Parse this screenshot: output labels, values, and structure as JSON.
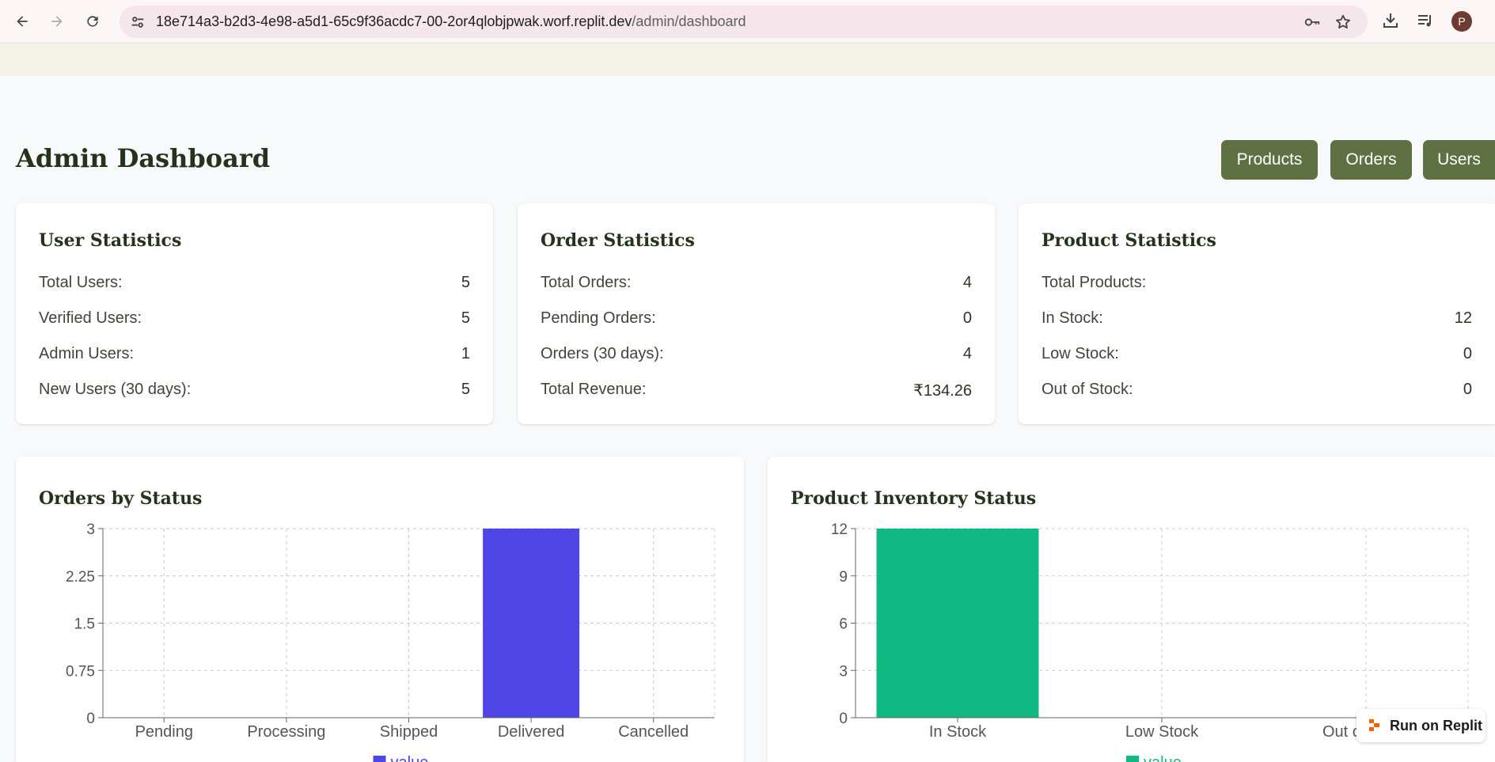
{
  "browser": {
    "url_host": "18e714a3-b2d3-4e98-a5d1-65c9f36acdc7-00-2or4qlobjpwak.worf.replit.dev",
    "url_path": "/admin/dashboard",
    "avatar_letter": "P",
    "icons": [
      "back-icon",
      "forward-icon",
      "reload-icon",
      "site-settings-icon",
      "password-key-icon",
      "bookmark-star-icon",
      "download-icon",
      "media-queue-icon"
    ]
  },
  "page": {
    "title": "Admin Dashboard",
    "nav_buttons": [
      "Products",
      "Orders",
      "Users"
    ],
    "accent_color": "#5f7142"
  },
  "user_stats": {
    "title": "User Statistics",
    "rows": [
      {
        "label": "Total Users:",
        "value": "5"
      },
      {
        "label": "Verified Users:",
        "value": "5"
      },
      {
        "label": "Admin Users:",
        "value": "1"
      },
      {
        "label": "New Users (30 days):",
        "value": "5"
      }
    ]
  },
  "order_stats": {
    "title": "Order Statistics",
    "rows": [
      {
        "label": "Total Orders:",
        "value": "4"
      },
      {
        "label": "Pending Orders:",
        "value": "0"
      },
      {
        "label": "Orders (30 days):",
        "value": "4"
      },
      {
        "label": "Total Revenue:",
        "value": "₹134.26"
      }
    ]
  },
  "product_stats": {
    "title": "Product Statistics",
    "rows": [
      {
        "label": "Total Products:",
        "value": ""
      },
      {
        "label": "In Stock:",
        "value": "12"
      },
      {
        "label": "Low Stock:",
        "value": "0"
      },
      {
        "label": "Out of Stock:",
        "value": "0"
      }
    ]
  },
  "chart_data": [
    {
      "type": "bar",
      "title": "Orders by Status",
      "categories": [
        "Pending",
        "Processing",
        "Shipped",
        "Delivered",
        "Cancelled"
      ],
      "values": [
        0,
        0,
        0,
        3,
        0
      ],
      "yticks": [
        "0",
        "0.75",
        "1.5",
        "2.25",
        "3"
      ],
      "ylim": [
        0,
        3
      ],
      "grid": true,
      "legend": "value",
      "color": "#4f46e5"
    },
    {
      "type": "bar",
      "title": "Product Inventory Status",
      "categories": [
        "In Stock",
        "Low Stock",
        "Out of Stock"
      ],
      "values": [
        12,
        0,
        0
      ],
      "yticks": [
        "0",
        "3",
        "6",
        "9",
        "12"
      ],
      "ylim": [
        0,
        12
      ],
      "grid": true,
      "legend": "value",
      "color": "#10b981"
    }
  ],
  "replit_badge": {
    "label": "Run on Replit"
  }
}
